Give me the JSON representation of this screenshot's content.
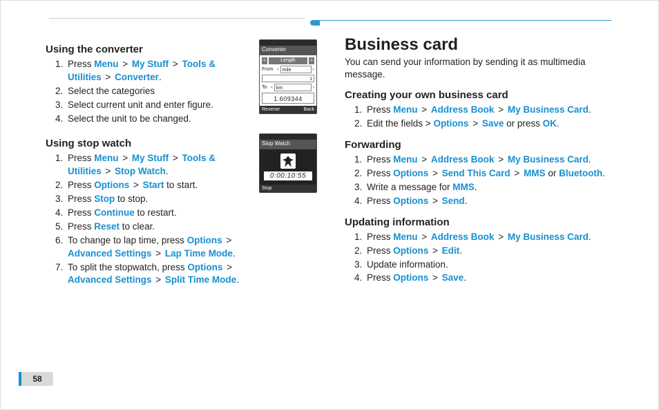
{
  "page_number": "58",
  "left": {
    "section1": {
      "title": "Using the converter",
      "steps": [
        [
          [
            "t",
            "Press "
          ],
          [
            "hl",
            "Menu"
          ],
          [
            "gt",
            " > "
          ],
          [
            "hl",
            "My Stuff"
          ],
          [
            "gt",
            " > "
          ],
          [
            "hl",
            "Tools & Utilities"
          ],
          [
            "gt",
            " > "
          ],
          [
            "hl",
            "Converter"
          ],
          [
            "t",
            "."
          ]
        ],
        [
          [
            "t",
            "Select the categories"
          ]
        ],
        [
          [
            "t",
            "Select current unit and enter figure."
          ]
        ],
        [
          [
            "t",
            "Select the unit to be changed."
          ]
        ]
      ],
      "device": {
        "title": "Converter",
        "category": "Length",
        "from_label": "From",
        "from_unit": "mile",
        "from_value": "1",
        "to_label": "To",
        "to_unit": "km",
        "result": "1.609344",
        "soft_left": "Reverse",
        "soft_right": "Back"
      }
    },
    "section2": {
      "title": "Using stop watch",
      "steps": [
        [
          [
            "t",
            "Press "
          ],
          [
            "hl",
            "Menu"
          ],
          [
            "gt",
            " > "
          ],
          [
            "hl",
            "My Stuff"
          ],
          [
            "gt",
            " > "
          ],
          [
            "hl",
            "Tools & Utilities"
          ],
          [
            "gt",
            " > "
          ],
          [
            "hl",
            "Stop Watch"
          ],
          [
            "t",
            "."
          ]
        ],
        [
          [
            "t",
            "Press "
          ],
          [
            "hl",
            "Options"
          ],
          [
            "gt",
            " > "
          ],
          [
            "hl",
            "Start"
          ],
          [
            "t",
            " to start."
          ]
        ],
        [
          [
            "t",
            "Press "
          ],
          [
            "hl",
            "Stop"
          ],
          [
            "t",
            " to stop."
          ]
        ],
        [
          [
            "t",
            "Press "
          ],
          [
            "hl",
            "Continue"
          ],
          [
            "t",
            " to restart."
          ]
        ],
        [
          [
            "t",
            "Press "
          ],
          [
            "hl",
            "Reset"
          ],
          [
            "t",
            " to clear."
          ]
        ],
        [
          [
            "t",
            "To change to lap time, press "
          ],
          [
            "hl",
            "Options"
          ],
          [
            "gt",
            " > "
          ],
          [
            "hl",
            "Advanced Settings"
          ],
          [
            "gt",
            " > "
          ],
          [
            "hl",
            "Lap Time Mode"
          ],
          [
            "t",
            "."
          ]
        ],
        [
          [
            "t",
            "To split the stopwatch, press "
          ],
          [
            "hl",
            "Options"
          ],
          [
            "gt",
            " > "
          ],
          [
            "hl",
            "Advanced Settings"
          ],
          [
            "gt",
            " > "
          ],
          [
            "hl",
            "Split Time Mode"
          ],
          [
            "t",
            "."
          ]
        ]
      ],
      "device": {
        "title": "Stop Watch",
        "time": "0:00:10:55",
        "soft_left": "Stop"
      }
    }
  },
  "right": {
    "title": "Business card",
    "intro": "You can send your information by sending it as multimedia message.",
    "section1": {
      "title": "Creating your own business card",
      "steps": [
        [
          [
            "t",
            "Press "
          ],
          [
            "hl",
            "Menu"
          ],
          [
            "gt",
            " > "
          ],
          [
            "hl",
            "Address Book"
          ],
          [
            "gt",
            " > "
          ],
          [
            "hl",
            "My Business Card"
          ],
          [
            "t",
            "."
          ]
        ],
        [
          [
            "t",
            "Edit the fields > "
          ],
          [
            "hl",
            "Options"
          ],
          [
            "gt",
            " > "
          ],
          [
            "hl",
            "Save"
          ],
          [
            "t",
            " or press "
          ],
          [
            "hl",
            "OK"
          ],
          [
            "t",
            "."
          ]
        ]
      ]
    },
    "section2": {
      "title": "Forwarding",
      "steps": [
        [
          [
            "t",
            "Press "
          ],
          [
            "hl",
            "Menu"
          ],
          [
            "gt",
            " > "
          ],
          [
            "hl",
            "Address Book"
          ],
          [
            "gt",
            " > "
          ],
          [
            "hl",
            "My Business Card"
          ],
          [
            "t",
            "."
          ]
        ],
        [
          [
            "t",
            "Press "
          ],
          [
            "hl",
            "Options"
          ],
          [
            "gt",
            " > "
          ],
          [
            "hl",
            "Send This Card"
          ],
          [
            "gt",
            " > "
          ],
          [
            "hl",
            "MMS"
          ],
          [
            "t",
            " or "
          ],
          [
            "hl",
            "Bluetooth"
          ],
          [
            "t",
            "."
          ]
        ],
        [
          [
            "t",
            "Write a message for "
          ],
          [
            "hl",
            "MMS"
          ],
          [
            "t",
            "."
          ]
        ],
        [
          [
            "t",
            "Press "
          ],
          [
            "hl",
            "Options"
          ],
          [
            "gt",
            " > "
          ],
          [
            "hl",
            "Send"
          ],
          [
            "t",
            "."
          ]
        ]
      ]
    },
    "section3": {
      "title": "Updating information",
      "steps": [
        [
          [
            "t",
            "Press "
          ],
          [
            "hl",
            "Menu"
          ],
          [
            "gt",
            " > "
          ],
          [
            "hl",
            "Address Book"
          ],
          [
            "gt",
            " > "
          ],
          [
            "hl",
            "My Business Card"
          ],
          [
            "t",
            "."
          ]
        ],
        [
          [
            "t",
            "Press "
          ],
          [
            "hl",
            "Options"
          ],
          [
            "gt",
            " > "
          ],
          [
            "hl",
            "Edit"
          ],
          [
            "t",
            "."
          ]
        ],
        [
          [
            "t",
            "Update information."
          ]
        ],
        [
          [
            "t",
            "Press "
          ],
          [
            "hl",
            "Options"
          ],
          [
            "gt",
            " > "
          ],
          [
            "hl",
            "Save"
          ],
          [
            "t",
            "."
          ]
        ]
      ]
    }
  }
}
